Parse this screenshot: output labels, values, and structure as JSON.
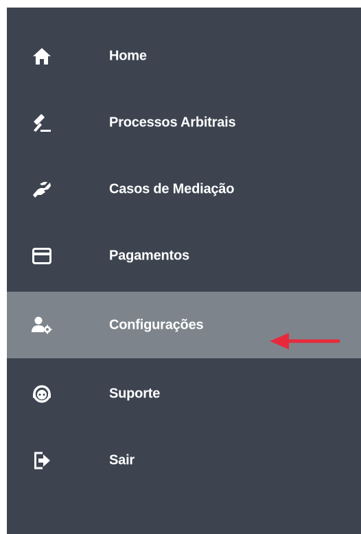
{
  "sidebar": {
    "background": "#3d4450",
    "active_background": "#7d848b",
    "text_color": "#ffffff",
    "items": [
      {
        "label": "Home",
        "icon": "home-icon"
      },
      {
        "label": "Processos Arbitrais",
        "icon": "gavel-icon"
      },
      {
        "label": "Casos de Mediação",
        "icon": "handshake-icon"
      },
      {
        "label": "Pagamentos",
        "icon": "credit-card-icon"
      },
      {
        "label": "Configurações",
        "icon": "user-settings-icon",
        "active": true
      },
      {
        "label": "Suporte",
        "icon": "support-agent-icon"
      },
      {
        "label": "Sair",
        "icon": "logout-icon"
      }
    ]
  },
  "annotation": {
    "arrow_color": "#e8293c",
    "arrow_icon": "left-arrow-icon"
  }
}
